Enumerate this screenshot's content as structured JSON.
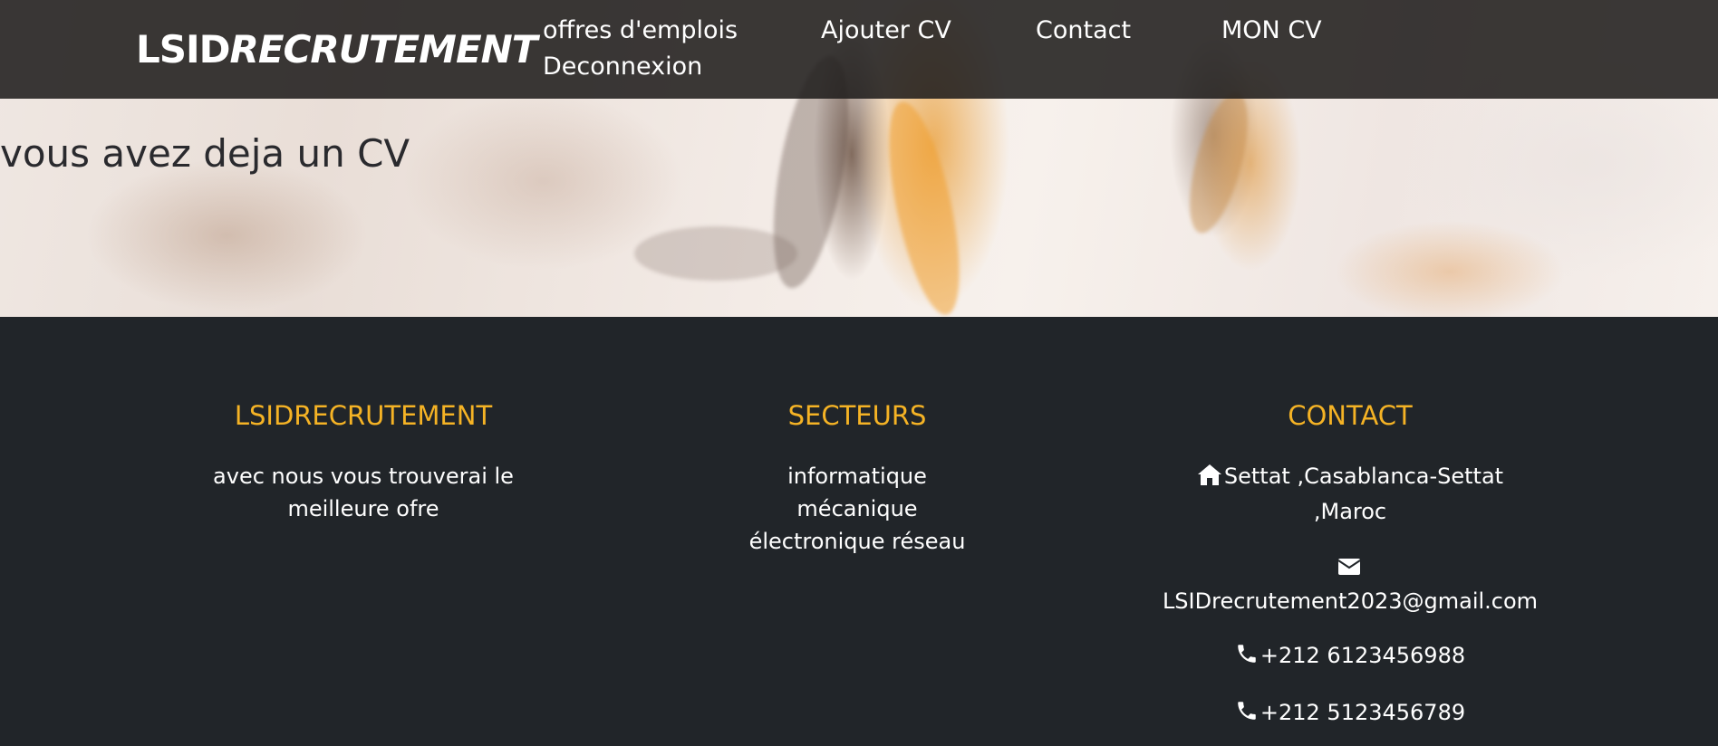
{
  "navbar": {
    "brand_part1": "LSID",
    "brand_part2": "RECRUTEMENT",
    "links": [
      {
        "label": "offres d'emplois"
      },
      {
        "label": "Ajouter CV"
      },
      {
        "label": "Contact"
      },
      {
        "label": "MON CV"
      },
      {
        "label": "Deconnexion"
      }
    ]
  },
  "hero": {
    "message": "vous avez deja un CV"
  },
  "footer": {
    "about": {
      "title": "LSIDRECRUTEMENT",
      "line1": "avec nous vous trouverai le",
      "line2": "meilleure ofre"
    },
    "sectors": {
      "title": "SECTEURS",
      "items": [
        "informatique",
        "mécanique",
        "électronique réseau"
      ]
    },
    "contact": {
      "title": "CONTACT",
      "address_line1": "Settat ,Casablanca-Settat",
      "address_line2": ",Maroc",
      "email": "LSIDrecrutement2023@gmail.com",
      "phone1": "+212 6123456988",
      "phone2": "+212 5123456789"
    }
  },
  "icons": {
    "address": "home-icon",
    "email": "envelope-icon",
    "phone": "phone-icon"
  },
  "colors": {
    "accent": "#f5b325",
    "footer_bg": "#212529",
    "navbar_bg": "#201e1c"
  }
}
